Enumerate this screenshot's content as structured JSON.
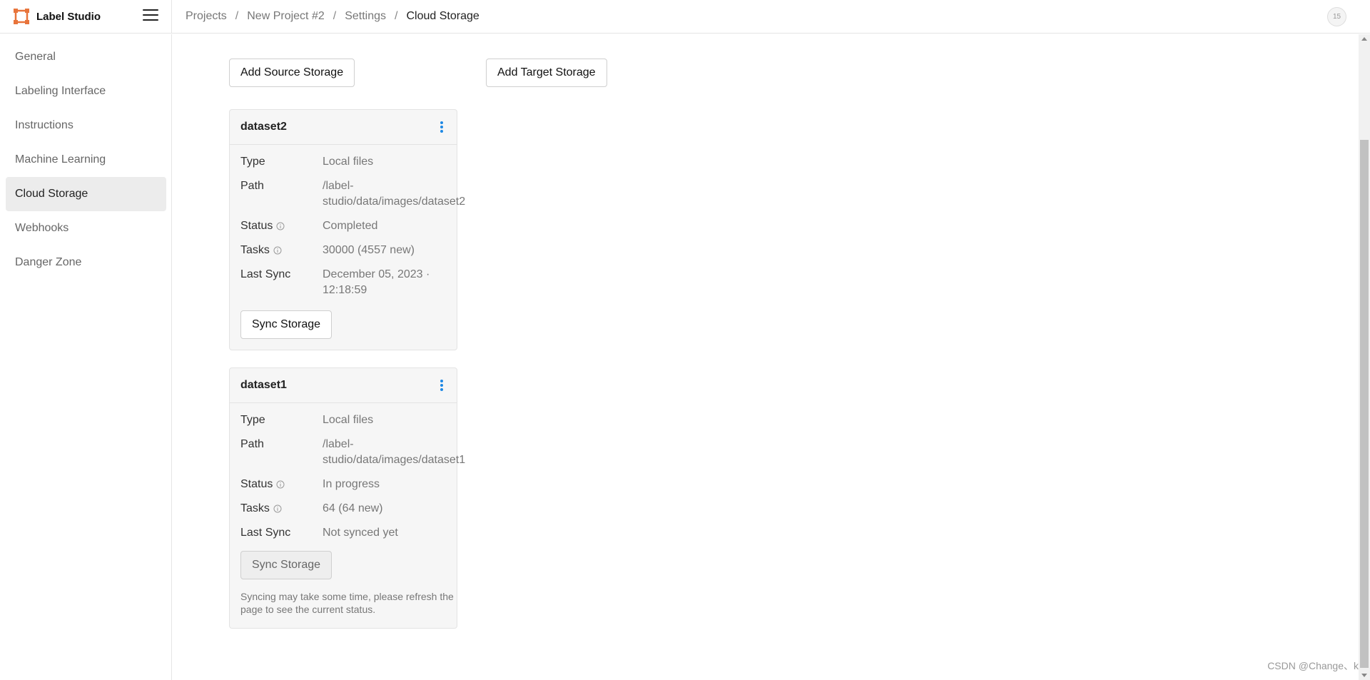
{
  "app": {
    "name": "Label Studio",
    "accent_color": "#e8743b",
    "link_color": "#1e88e5",
    "avatar_initials": "15"
  },
  "breadcrumb": [
    "Projects",
    "New Project #2",
    "Settings",
    "Cloud Storage"
  ],
  "breadcrumb_separator": "/",
  "sidebar": {
    "items": [
      {
        "label": "General"
      },
      {
        "label": "Labeling Interface"
      },
      {
        "label": "Instructions"
      },
      {
        "label": "Machine Learning"
      },
      {
        "label": "Cloud Storage",
        "active": true
      },
      {
        "label": "Webhooks"
      },
      {
        "label": "Danger Zone"
      }
    ]
  },
  "actions": {
    "add_source": "Add Source Storage",
    "add_target": "Add Target Storage"
  },
  "storages": [
    {
      "title": "dataset2",
      "type_label": "Type",
      "type_value": "Local files",
      "path_label": "Path",
      "path_line1": "/label-",
      "path_line2": "studio/data/images/dataset2",
      "status_label": "Status",
      "status_value": "Completed",
      "tasks_label": "Tasks",
      "tasks_value": "30000 (4557 new)",
      "sync_label": "Last Sync",
      "sync_line1": "December 05, 2023 ·",
      "sync_line2": "12:18:59",
      "button": "Sync Storage"
    },
    {
      "title": "dataset1",
      "type_label": "Type",
      "type_value": "Local files",
      "path_label": "Path",
      "path_line1": "/label-",
      "path_line2": "studio/data/images/dataset1",
      "status_label": "Status",
      "status_value": "In progress",
      "tasks_label": "Tasks",
      "tasks_value": "64 (64 new)",
      "sync_label": "Last Sync",
      "sync_line1": "Not synced yet",
      "button": "Sync Storage",
      "hint": "Syncing may take some time, please refresh the page to see the current status."
    }
  ],
  "watermark": "CSDN @Change、k"
}
